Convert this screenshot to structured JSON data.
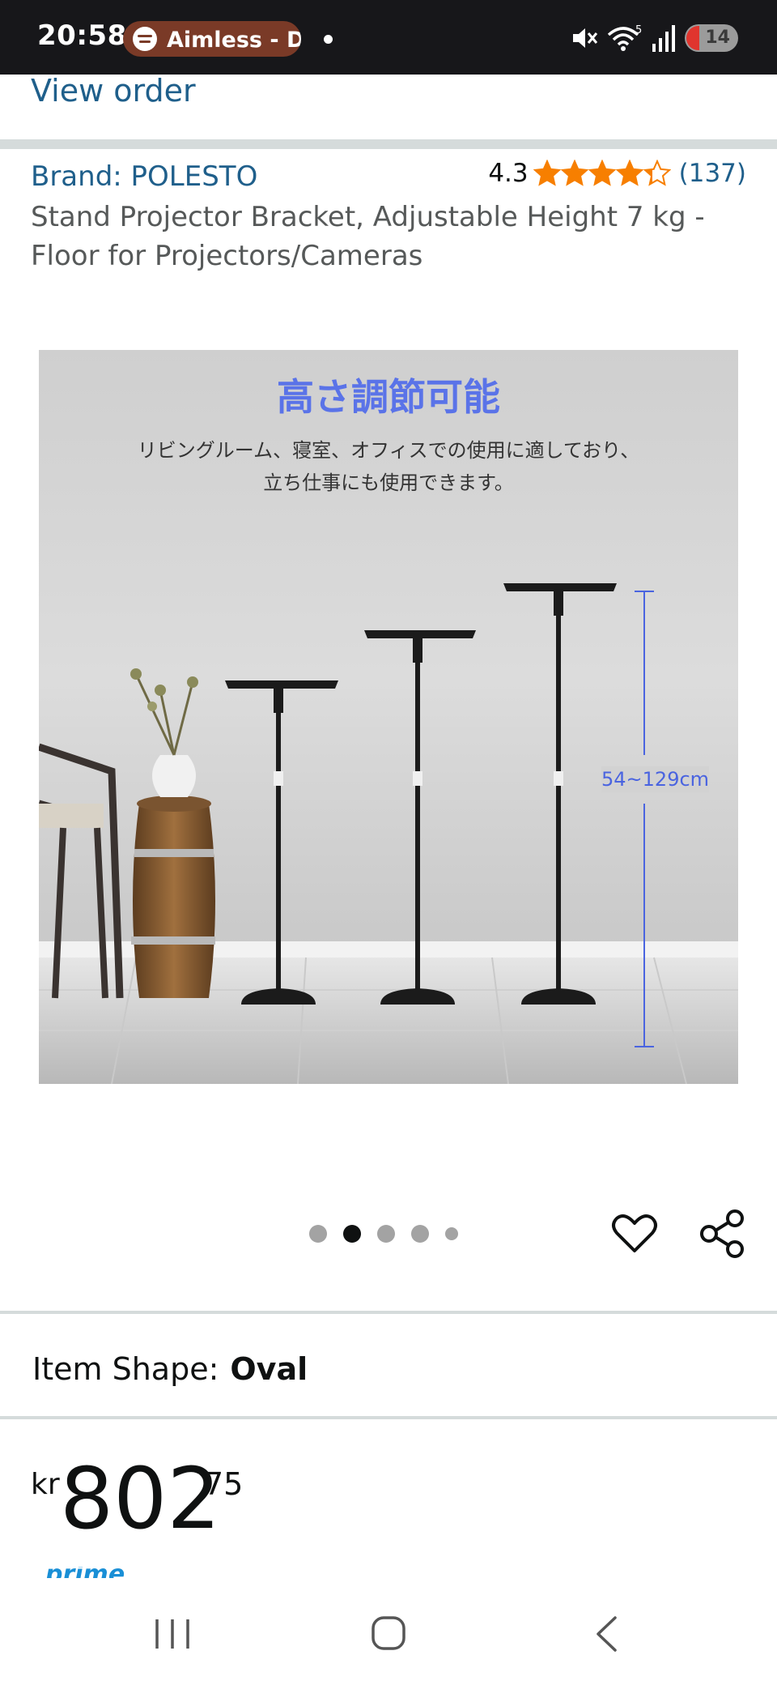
{
  "status_bar": {
    "time": "20:58",
    "media_label": "Aimless - D",
    "battery_level": "14",
    "wifi_badge": "5"
  },
  "order": {
    "view_order_label": "View order"
  },
  "product": {
    "brand": "Brand: POLESTO",
    "rating": "4.3",
    "rating_stars": 4.3,
    "rating_count": "(137)",
    "title": "Stand Projector Bracket, Adjustable Height 7 kg - Floor for Projectors/Cameras"
  },
  "product_image": {
    "heading": "高さ調節可能",
    "subtitle": "リビングルーム、寝室、オフィスでの使用に適しており、\n立ち仕事にも使用できます。",
    "measurement": "54~129cm"
  },
  "carousel": {
    "total": 5,
    "active_index": 1
  },
  "attributes": {
    "item_shape_label": "Item Shape:",
    "item_shape_value": "Oval"
  },
  "price": {
    "currency": "kr",
    "whole": "802",
    "fraction": "75"
  },
  "colors": {
    "link": "#1f5f8b",
    "star": "#f77f00",
    "status_bar": "#17171a",
    "divider": "#d5dbdb",
    "image_accent": "#5a73e8"
  }
}
